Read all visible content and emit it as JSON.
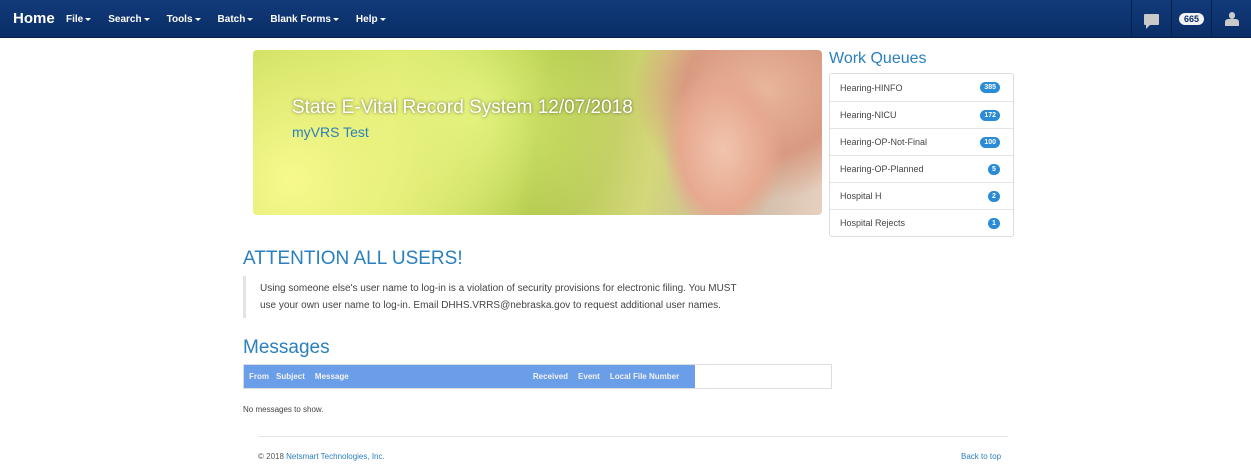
{
  "nav": {
    "home": "Home",
    "menus": [
      "File",
      "Search",
      "Tools",
      "Batch",
      "Blank Forms",
      "Help"
    ],
    "notification_count": "665"
  },
  "hero": {
    "title": "State E-Vital Record System 12/07/2018",
    "subtitle": "myVRS Test"
  },
  "work_queues": {
    "title": "Work Queues",
    "items": [
      {
        "label": "Hearing-HINFO",
        "count": "385"
      },
      {
        "label": "Hearing-NICU",
        "count": "172"
      },
      {
        "label": "Hearing-OP-Not-Final",
        "count": "100"
      },
      {
        "label": "Hearing-OP-Planned",
        "count": "5"
      },
      {
        "label": "Hospital H",
        "count": "2"
      },
      {
        "label": "Hospital Rejects",
        "count": "1"
      }
    ]
  },
  "attention": {
    "title": "ATTENTION ALL USERS!",
    "line1": "Using someone else's user name to log-in is a violation of security provisions for electronic filing. You MUST",
    "line2": "use your own user name to log-in. Email DHHS.VRRS@nebraska.gov to request additional user names."
  },
  "messages": {
    "title": "Messages",
    "columns": [
      "From",
      "Subject",
      "Message",
      "Received",
      "Event",
      "Local File Number"
    ],
    "empty": "No messages to show."
  },
  "footer": {
    "copyright_prefix": "© 2018 ",
    "company": "Netsmart Technologies, Inc.",
    "back_to_top": "Back to top"
  },
  "colors": {
    "navbar": "#0a2e66",
    "accent": "#2a7fbf",
    "badge": "#2a8bd6",
    "table_header": "#6b9ee8"
  }
}
